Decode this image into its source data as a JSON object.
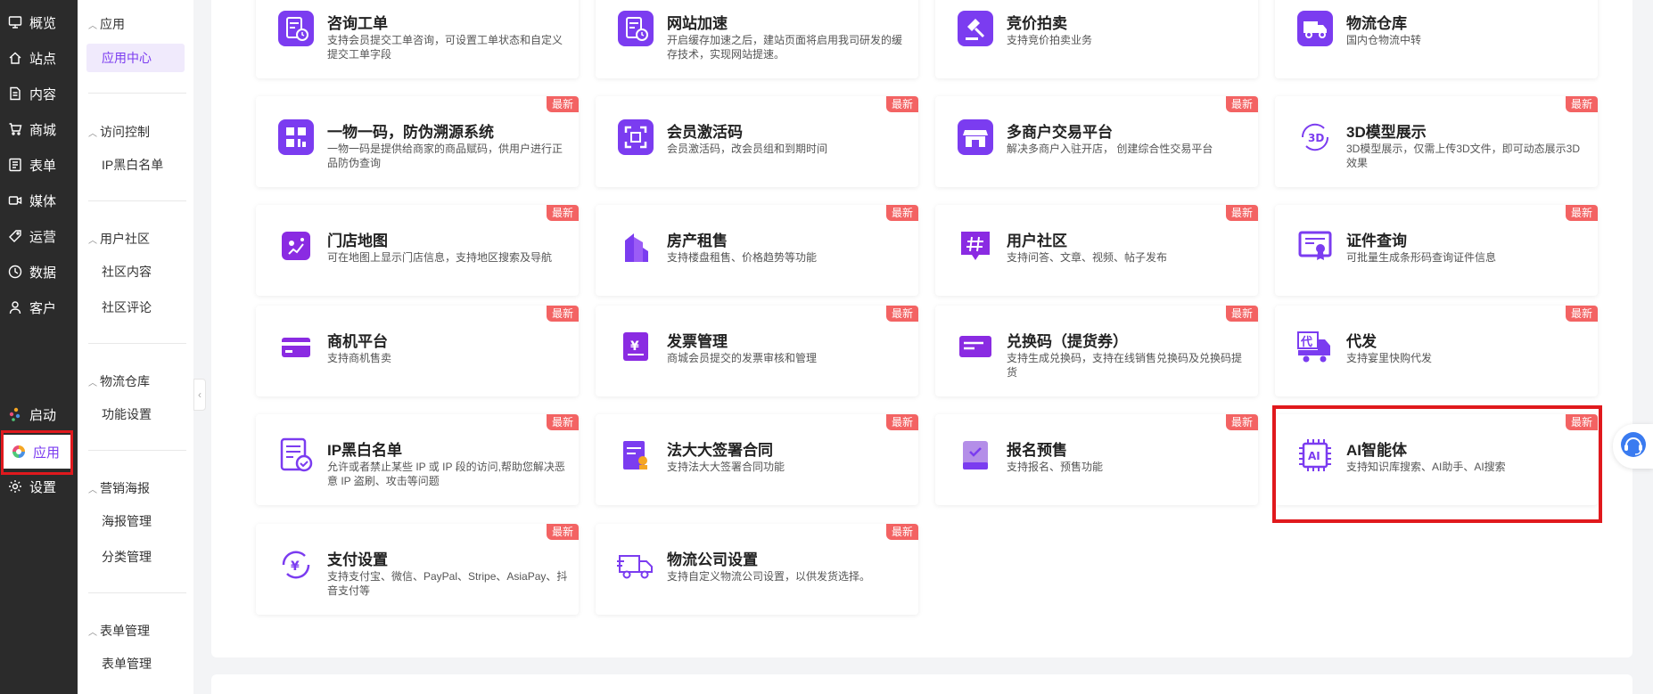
{
  "rail": {
    "items": [
      {
        "label": "概览",
        "icon": "monitor-icon"
      },
      {
        "label": "站点",
        "icon": "home-icon"
      },
      {
        "label": "内容",
        "icon": "document-icon"
      },
      {
        "label": "商城",
        "icon": "cart-icon"
      },
      {
        "label": "表单",
        "icon": "form-icon"
      },
      {
        "label": "媒体",
        "icon": "video-icon"
      },
      {
        "label": "运营",
        "icon": "tag-icon"
      },
      {
        "label": "数据",
        "icon": "chart-icon"
      },
      {
        "label": "客户",
        "icon": "user-icon"
      }
    ],
    "bottom": [
      {
        "label": "启动",
        "icon": "launch-icon"
      },
      {
        "label": "应用",
        "icon": "app-icon"
      },
      {
        "label": "设置",
        "icon": "gear-icon"
      }
    ]
  },
  "sub": {
    "groups": [
      {
        "title": "应用",
        "links": [
          "应用中心"
        ]
      },
      {
        "title": "访问控制",
        "links": [
          "IP黑白名单"
        ]
      },
      {
        "title": "用户社区",
        "links": [
          "社区内容",
          "社区评论"
        ]
      },
      {
        "title": "物流仓库",
        "links": [
          "功能设置"
        ]
      },
      {
        "title": "营销海报",
        "links": [
          "海报管理",
          "分类管理"
        ]
      },
      {
        "title": "表单管理",
        "links": [
          "表单管理"
        ]
      }
    ]
  },
  "badge": "最新",
  "cards": [
    {
      "title": "咨询工单",
      "desc": "支持会员提交工单咨询，可设置工单状态和自定义提交工单字段",
      "icon": "ticket-icon",
      "badge": false
    },
    {
      "title": "网站加速",
      "desc": "开启缓存加速之后，建站页面将启用我司研发的缓存技术，实现网站提速。",
      "icon": "speed-icon",
      "badge": false
    },
    {
      "title": "竞价拍卖",
      "desc": "支持竞价拍卖业务",
      "icon": "gavel-icon",
      "badge": false
    },
    {
      "title": "物流仓库",
      "desc": "国内仓物流中转",
      "icon": "truck-icon",
      "badge": false
    },
    {
      "title": "一物一码，防伪溯源系统",
      "desc": "一物一码是提供给商家的商品赋码，供用户进行正品防伪查询",
      "icon": "qrcode-icon",
      "badge": true
    },
    {
      "title": "会员激活码",
      "desc": "会员激活码，改会员组和到期时间",
      "icon": "scan-icon",
      "badge": true
    },
    {
      "title": "多商户交易平台",
      "desc": "解决多商户入驻开店， 创建综合性交易平台",
      "icon": "store-icon",
      "badge": true
    },
    {
      "title": "3D模型展示",
      "desc": "3D模型展示，仅需上传3D文件，即可动态展示3D效果",
      "icon": "3d-icon",
      "badge": true
    },
    {
      "title": "门店地图",
      "desc": "可在地图上显示门店信息，支持地区搜索及导航",
      "icon": "map-icon",
      "badge": true
    },
    {
      "title": "房产租售",
      "desc": "支持楼盘租售、价格趋势等功能",
      "icon": "building-icon",
      "badge": true
    },
    {
      "title": "用户社区",
      "desc": "支持问答、文章、视频、帖子发布",
      "icon": "hash-icon",
      "badge": true
    },
    {
      "title": "证件查询",
      "desc": "可批量生成条形码查询证件信息",
      "icon": "certificate-icon",
      "badge": true
    },
    {
      "title": "商机平台",
      "desc": "支持商机售卖",
      "icon": "card-icon",
      "badge": true
    },
    {
      "title": "发票管理",
      "desc": "商城会员提交的发票审核和管理",
      "icon": "invoice-icon",
      "badge": true
    },
    {
      "title": "兑换码（提货券）",
      "desc": "支持生成兑换码，支持在线销售兑换码及兑换码提货",
      "icon": "coupon-icon",
      "badge": true
    },
    {
      "title": "代发",
      "desc": "支持宴里快购代发",
      "icon": "delivery-icon",
      "badge": true
    },
    {
      "title": "IP黑白名单",
      "desc": "允许或者禁止某些 IP 或 IP 段的访问,帮助您解决恶意 IP 盗刷、攻击等问题",
      "icon": "ip-list-icon",
      "badge": true
    },
    {
      "title": "法大大签署合同",
      "desc": "支持法大大签署合同功能",
      "icon": "contract-icon",
      "badge": true
    },
    {
      "title": "报名预售",
      "desc": "支持报名、预售功能",
      "icon": "book-icon",
      "badge": true
    },
    {
      "title": "AI智能体",
      "desc": "支持知识库搜索、AI助手、AI搜索",
      "icon": "ai-chip-icon",
      "badge": true
    },
    {
      "title": "支付设置",
      "desc": "支持支付宝、微信、PayPal、Stripe、AsiaPay、抖音支付等",
      "icon": "payment-icon",
      "badge": true
    },
    {
      "title": "物流公司设置",
      "desc": "支持自定义物流公司设置，以供发货选择。",
      "icon": "logistics-icon",
      "badge": true
    }
  ],
  "colors": {
    "accent": "#7b3cf0",
    "badge": "#f36363",
    "rail": "#2b2b2b",
    "highlight": "#e0191d"
  }
}
